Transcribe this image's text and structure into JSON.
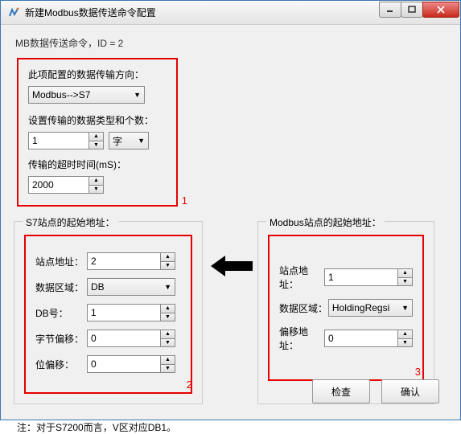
{
  "window": {
    "title": "新建Modbus数据传送命令配置"
  },
  "header": "MB数据传送命令，ID = 2",
  "box1": {
    "direction_label": "此项配置的数据传输方向：",
    "direction_value": "Modbus-->S7",
    "type_label": "设置传输的数据类型和个数：",
    "count_value": "1",
    "type_value": "字",
    "timeout_label": "传输的超时时间(mS)：",
    "timeout_value": "2000",
    "num": "1"
  },
  "s7": {
    "legend": "S7站点的起始地址：",
    "station_label": "站点地址：",
    "station_value": "2",
    "area_label": "数据区域：",
    "area_value": "DB",
    "db_label": "DB号：",
    "db_value": "1",
    "byte_label": "字节偏移：",
    "byte_value": "0",
    "bit_label": "位偏移：",
    "bit_value": "0",
    "num": "2"
  },
  "modbus": {
    "legend": "Modbus站点的起始地址：",
    "station_label": "站点地址：",
    "station_value": "1",
    "area_label": "数据区域：",
    "area_value": "HoldingRegsi",
    "offset_label": "偏移地址：",
    "offset_value": "0",
    "num": "3"
  },
  "footer_note": "注：对于S7200而言，V区对应DB1。",
  "buttons": {
    "check": "检查",
    "ok": "确认"
  }
}
